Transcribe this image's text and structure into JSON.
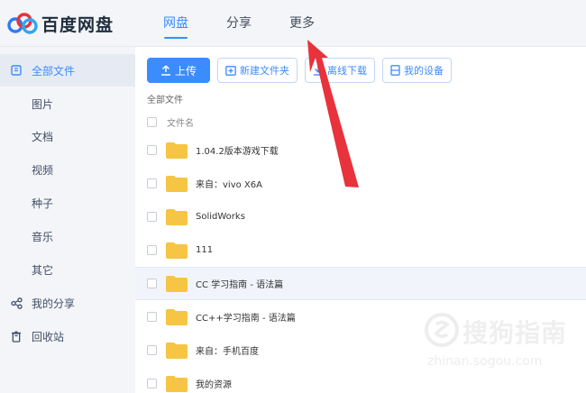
{
  "app": {
    "logo_text": "百度网盘"
  },
  "nav": {
    "tabs": [
      {
        "label": "网盘",
        "active": true
      },
      {
        "label": "分享"
      },
      {
        "label": "更多"
      }
    ]
  },
  "sidebar": {
    "items": [
      {
        "label": "全部文件",
        "active": true,
        "icon": "folder-icon"
      },
      {
        "label": "图片"
      },
      {
        "label": "文档"
      },
      {
        "label": "视频"
      },
      {
        "label": "种子"
      },
      {
        "label": "音乐"
      },
      {
        "label": "其它"
      },
      {
        "label": "我的分享",
        "icon": "share-icon"
      },
      {
        "label": "回收站",
        "icon": "trash-icon"
      }
    ]
  },
  "toolbar": {
    "upload_label": "上传",
    "new_folder_label": "新建文件夹",
    "offline_download_label": "离线下载",
    "my_devices_label": "我的设备"
  },
  "breadcrumb": "全部文件",
  "list": {
    "column_header": "文件名",
    "files": [
      {
        "name": "1.04.2版本游戏下载"
      },
      {
        "name": "来自：vivo X6A"
      },
      {
        "name": "SolidWorks"
      },
      {
        "name": "111"
      },
      {
        "name": "CC 学习指南 - 语法篇",
        "hovered": true
      },
      {
        "name": "CC++学习指南 - 语法篇"
      },
      {
        "name": "来自：手机百度"
      },
      {
        "name": "我的资源"
      }
    ]
  },
  "watermark": {
    "text": "搜狗指南",
    "url": "zhinan.sogou.com"
  },
  "colors": {
    "accent": "#3b8cff",
    "arrow": "#e8323c",
    "folder": "#f6c543"
  }
}
